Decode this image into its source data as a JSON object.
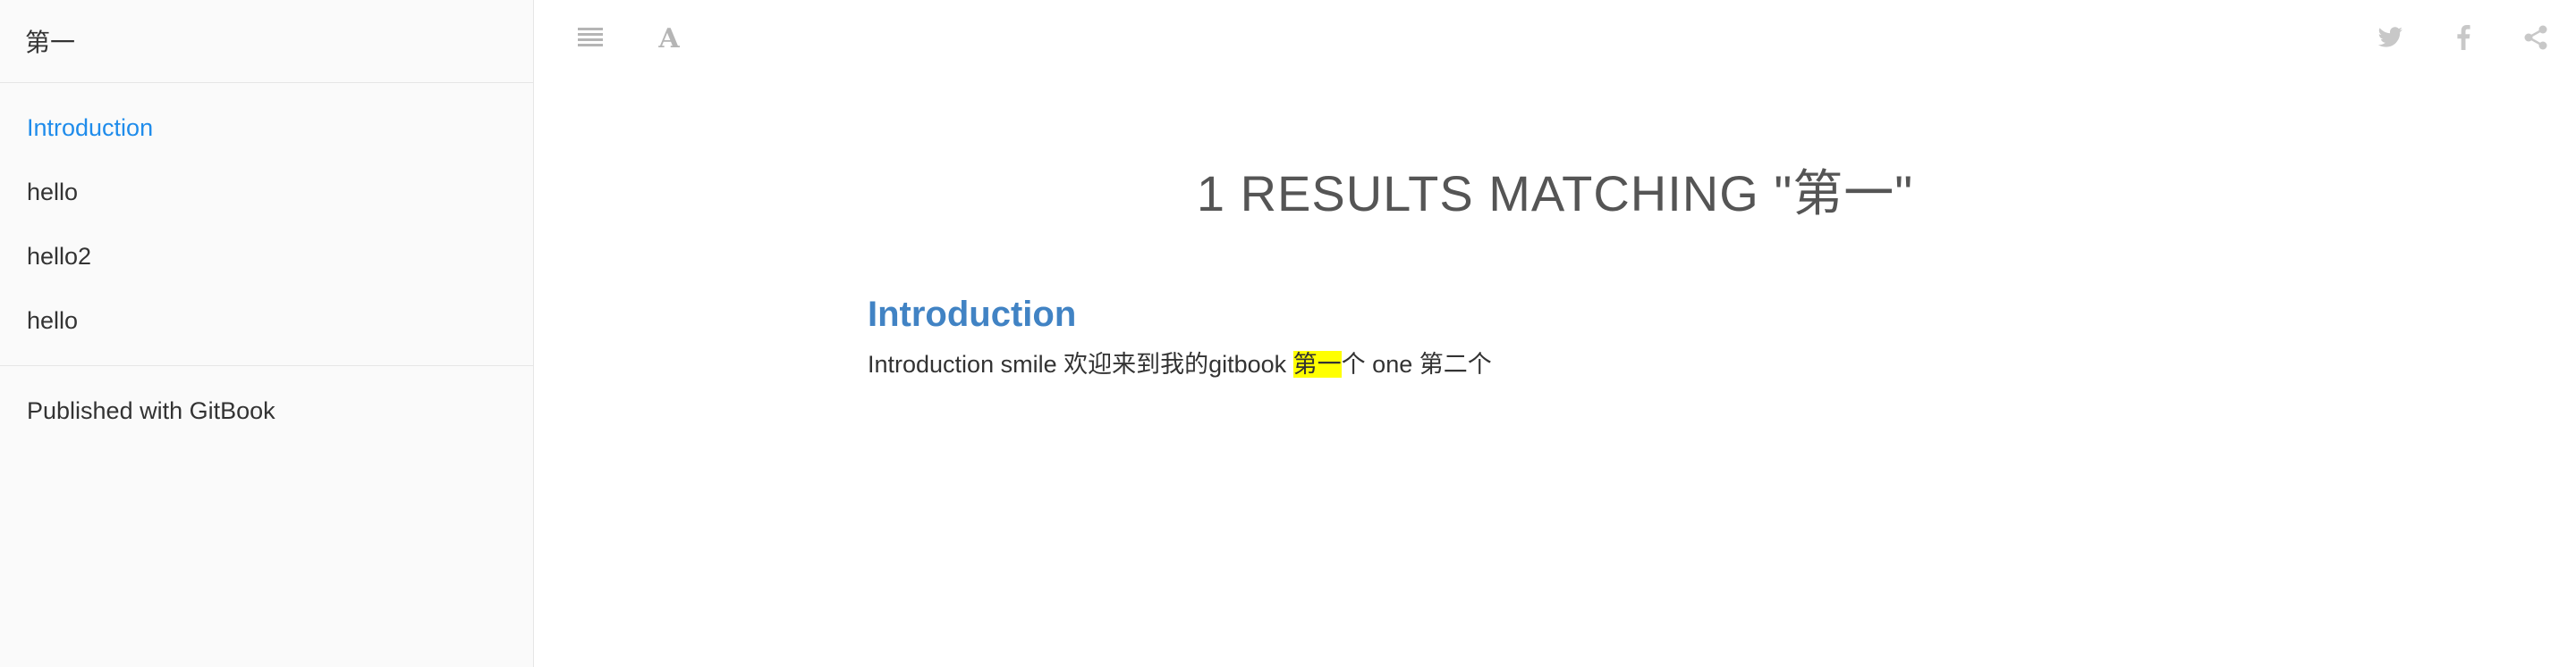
{
  "search": {
    "value": "第一",
    "placeholder": ""
  },
  "sidebar": {
    "items": [
      {
        "label": "Introduction",
        "active": true
      },
      {
        "label": "hello",
        "active": false
      },
      {
        "label": "hello2",
        "active": false
      },
      {
        "label": "hello",
        "active": false
      }
    ],
    "published_label": "Published with GitBook"
  },
  "toolbar": {
    "left_icons": [
      "menu-icon",
      "font-settings-icon"
    ],
    "right_icons": [
      "twitter-icon",
      "facebook-icon",
      "share-icon"
    ]
  },
  "results": {
    "heading": "1 RESULTS MATCHING \"第一\"",
    "items": [
      {
        "title": "Introduction",
        "text_before": "Introduction smile 欢迎来到我的gitbook ",
        "highlight": "第一",
        "text_after": "个 one 第二个"
      }
    ]
  },
  "colors": {
    "active_link": "#1f8ceb",
    "result_title": "#4183c4",
    "highlight": "#ffff00",
    "icon": "#b5b5b5",
    "sidebar_bg": "#fafafa"
  }
}
